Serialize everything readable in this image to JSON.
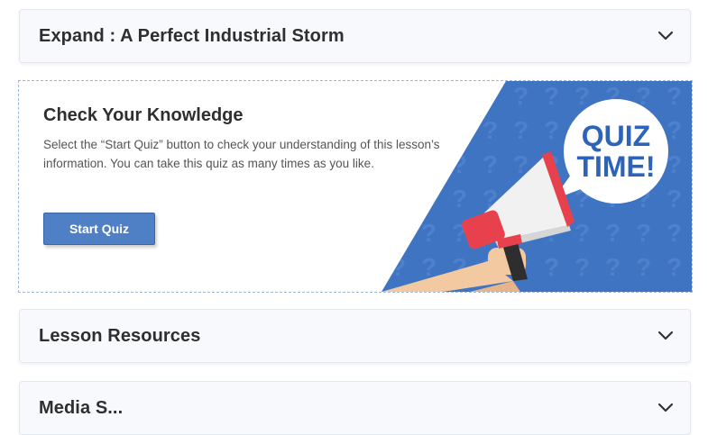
{
  "accordions": [
    {
      "title": "Expand : A Perfect Industrial Storm"
    },
    {
      "title": "Lesson Resources"
    },
    {
      "title": "Media S..."
    }
  ],
  "quiz": {
    "heading": "Check Your Knowledge",
    "description": "Select the “Start Quiz” button to check your understanding of this lesson’s information. You can take this quiz as many times as you like.",
    "button_label": "Start Quiz",
    "banner_text_line1": "QUIZ",
    "banner_text_line2": "TIME!"
  },
  "colors": {
    "accent": "#4f7fc5",
    "banner_blue": "#3f74c3",
    "megaphone_red": "#e8414e"
  },
  "icons": [
    "chevron-down-icon",
    "megaphone-icon",
    "question-mark-pattern"
  ]
}
